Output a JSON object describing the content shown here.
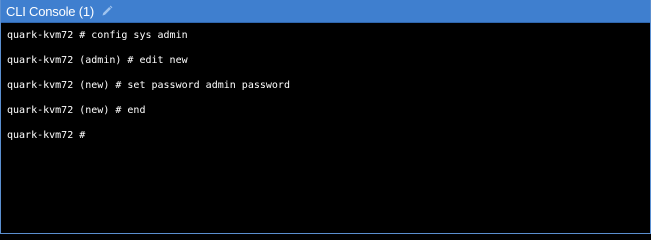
{
  "window": {
    "title": "CLI Console (1)"
  },
  "console": {
    "lines": [
      "quark-kvm72 # config sys admin",
      "quark-kvm72 (admin) # edit new",
      "quark-kvm72 (new) # set password admin password",
      "quark-kvm72 (new) # end",
      "quark-kvm72 #"
    ]
  },
  "colors": {
    "titlebar": "#3f7fcf",
    "background": "#000000",
    "text": "#ffffff"
  },
  "icons": {
    "edit": "pencil-icon"
  }
}
